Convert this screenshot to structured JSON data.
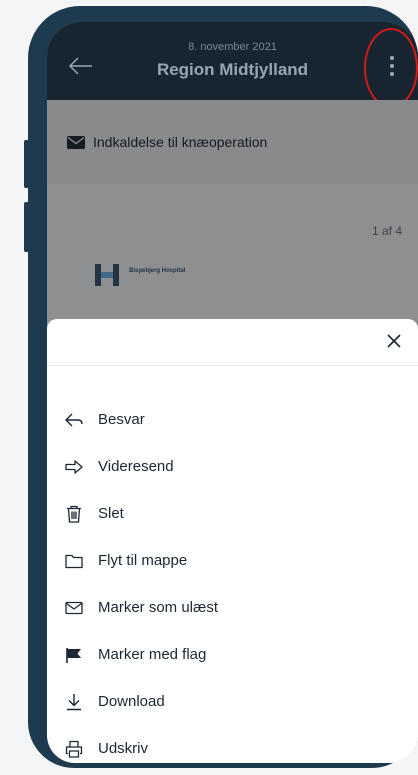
{
  "header": {
    "date": "8. november 2021",
    "title": "Region Midtjylland"
  },
  "message": {
    "subject": "Indkaldelse til knæoperation",
    "pager": "1 af 4",
    "logo_text": "Bispebjerg Hospital"
  },
  "menu": {
    "items": [
      {
        "label": "Besvar",
        "icon": "reply-icon"
      },
      {
        "label": "Videresend",
        "icon": "forward-icon"
      },
      {
        "label": "Slet",
        "icon": "trash-icon"
      },
      {
        "label": "Flyt til mappe",
        "icon": "folder-icon"
      },
      {
        "label": "Marker som ulæst",
        "icon": "envelope-icon"
      },
      {
        "label": "Marker med flag",
        "icon": "flag-icon"
      },
      {
        "label": "Download",
        "icon": "download-icon"
      },
      {
        "label": "Udskriv",
        "icon": "print-icon"
      }
    ]
  },
  "colors": {
    "header_bg": "#16252f",
    "phone_frame": "#1e3a4f",
    "highlight_ring": "#d21a1a"
  }
}
